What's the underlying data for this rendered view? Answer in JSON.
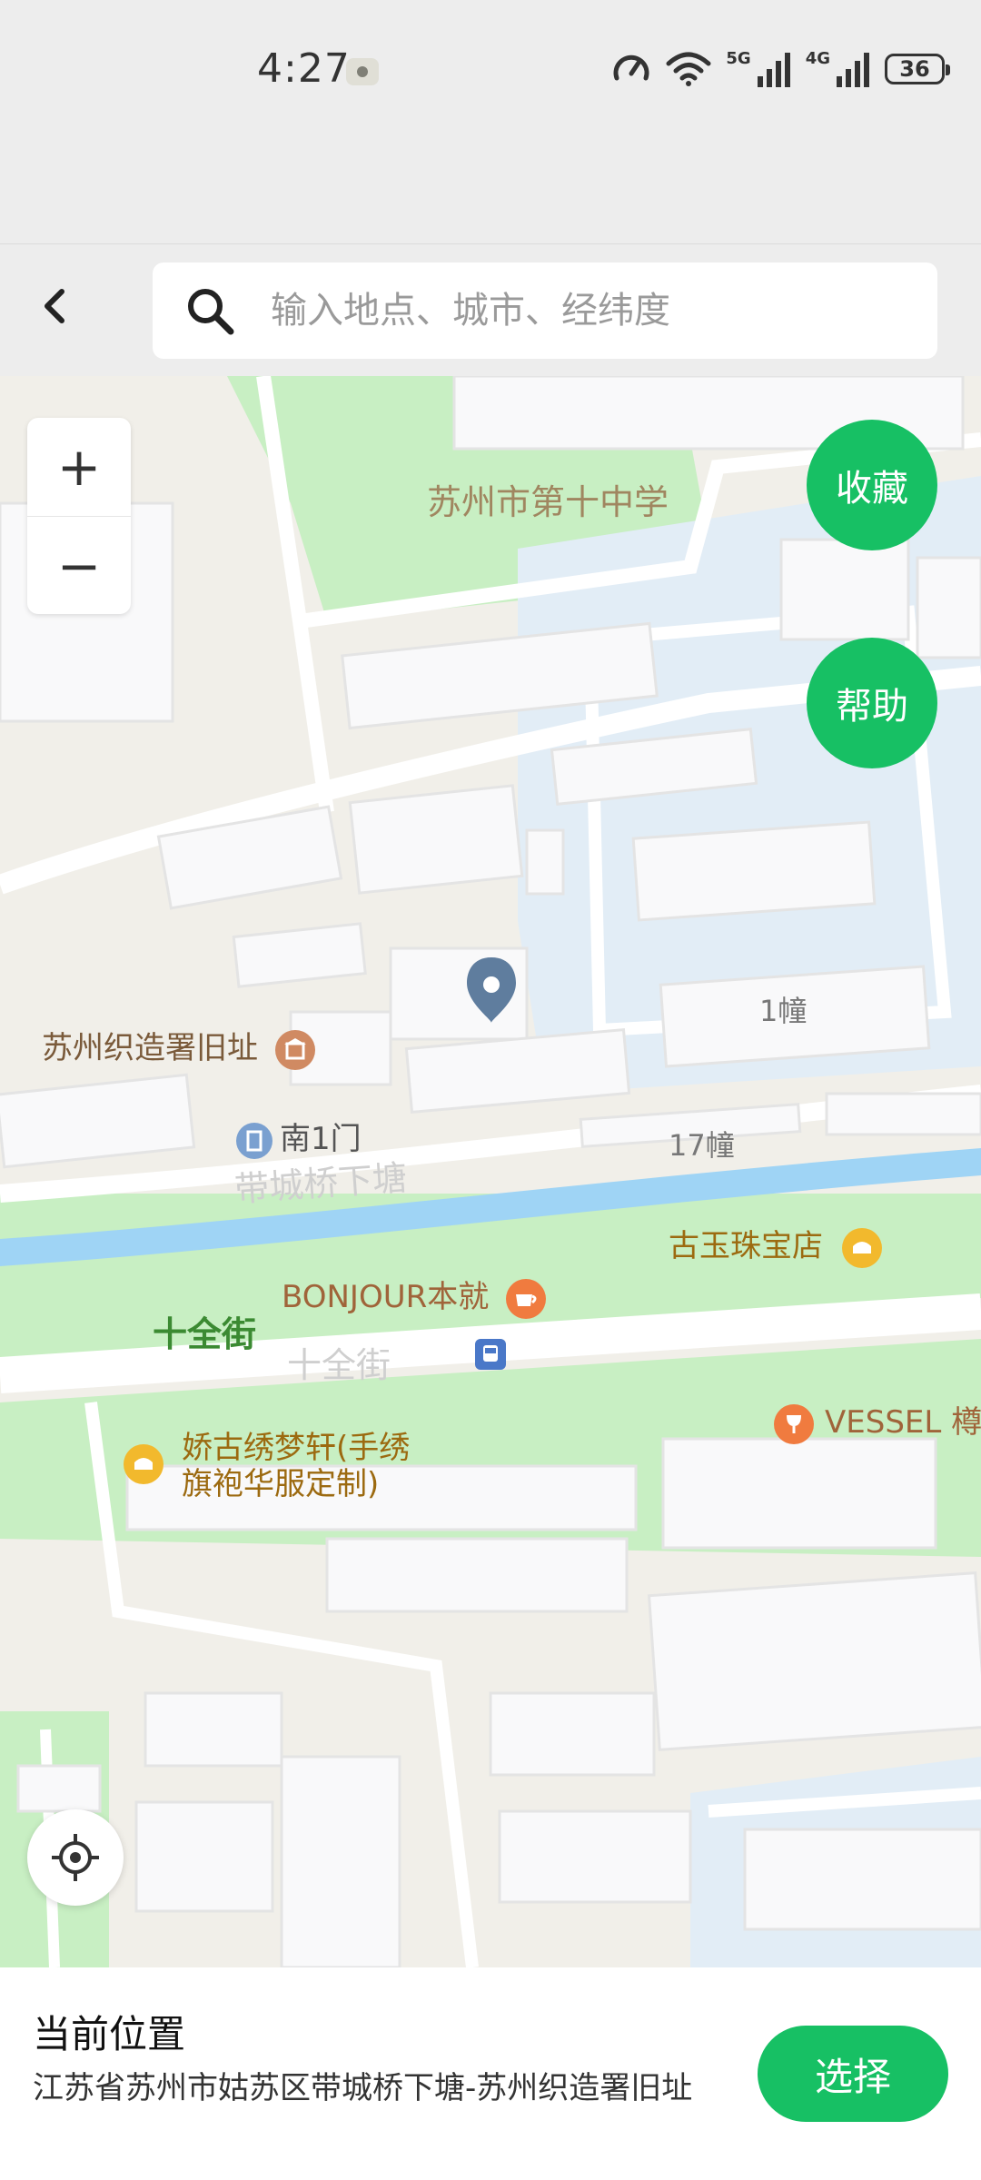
{
  "status_bar": {
    "time": "4:27",
    "network_1": "5G",
    "network_2": "4G",
    "battery": "36"
  },
  "header": {
    "search_placeholder": "输入地点、城市、经纬度"
  },
  "map": {
    "labels": {
      "school": "苏州市第十中学",
      "site": "苏州织造署旧址",
      "gate": "南1门",
      "road_daicheng": "带城桥下塘",
      "building_1": "1幢",
      "building_17": "17幢",
      "jewelry": "古玉珠宝店",
      "bonjour": "BONJOUR本就",
      "street_bold": "十全街",
      "street_faint": "十全街",
      "vessel": "VESSEL 樽",
      "jiaogu_line1": "娇古绣梦轩(手绣",
      "jiaogu_line2": "旗袍华服定制)"
    },
    "colors": {
      "land": "#f1efe9",
      "green": "#c8efc3",
      "water": "#9fd4f5",
      "blue_area": "#e2edf6",
      "building": "#f9f9fa",
      "accent": "#17c064"
    }
  },
  "controls": {
    "zoom_in": "+",
    "zoom_out": "−",
    "favorite": "收藏",
    "help": "帮助"
  },
  "bottom": {
    "title": "当前位置",
    "address": "江苏省苏州市姑苏区带城桥下塘-苏州织造署旧址",
    "select": "选择"
  }
}
